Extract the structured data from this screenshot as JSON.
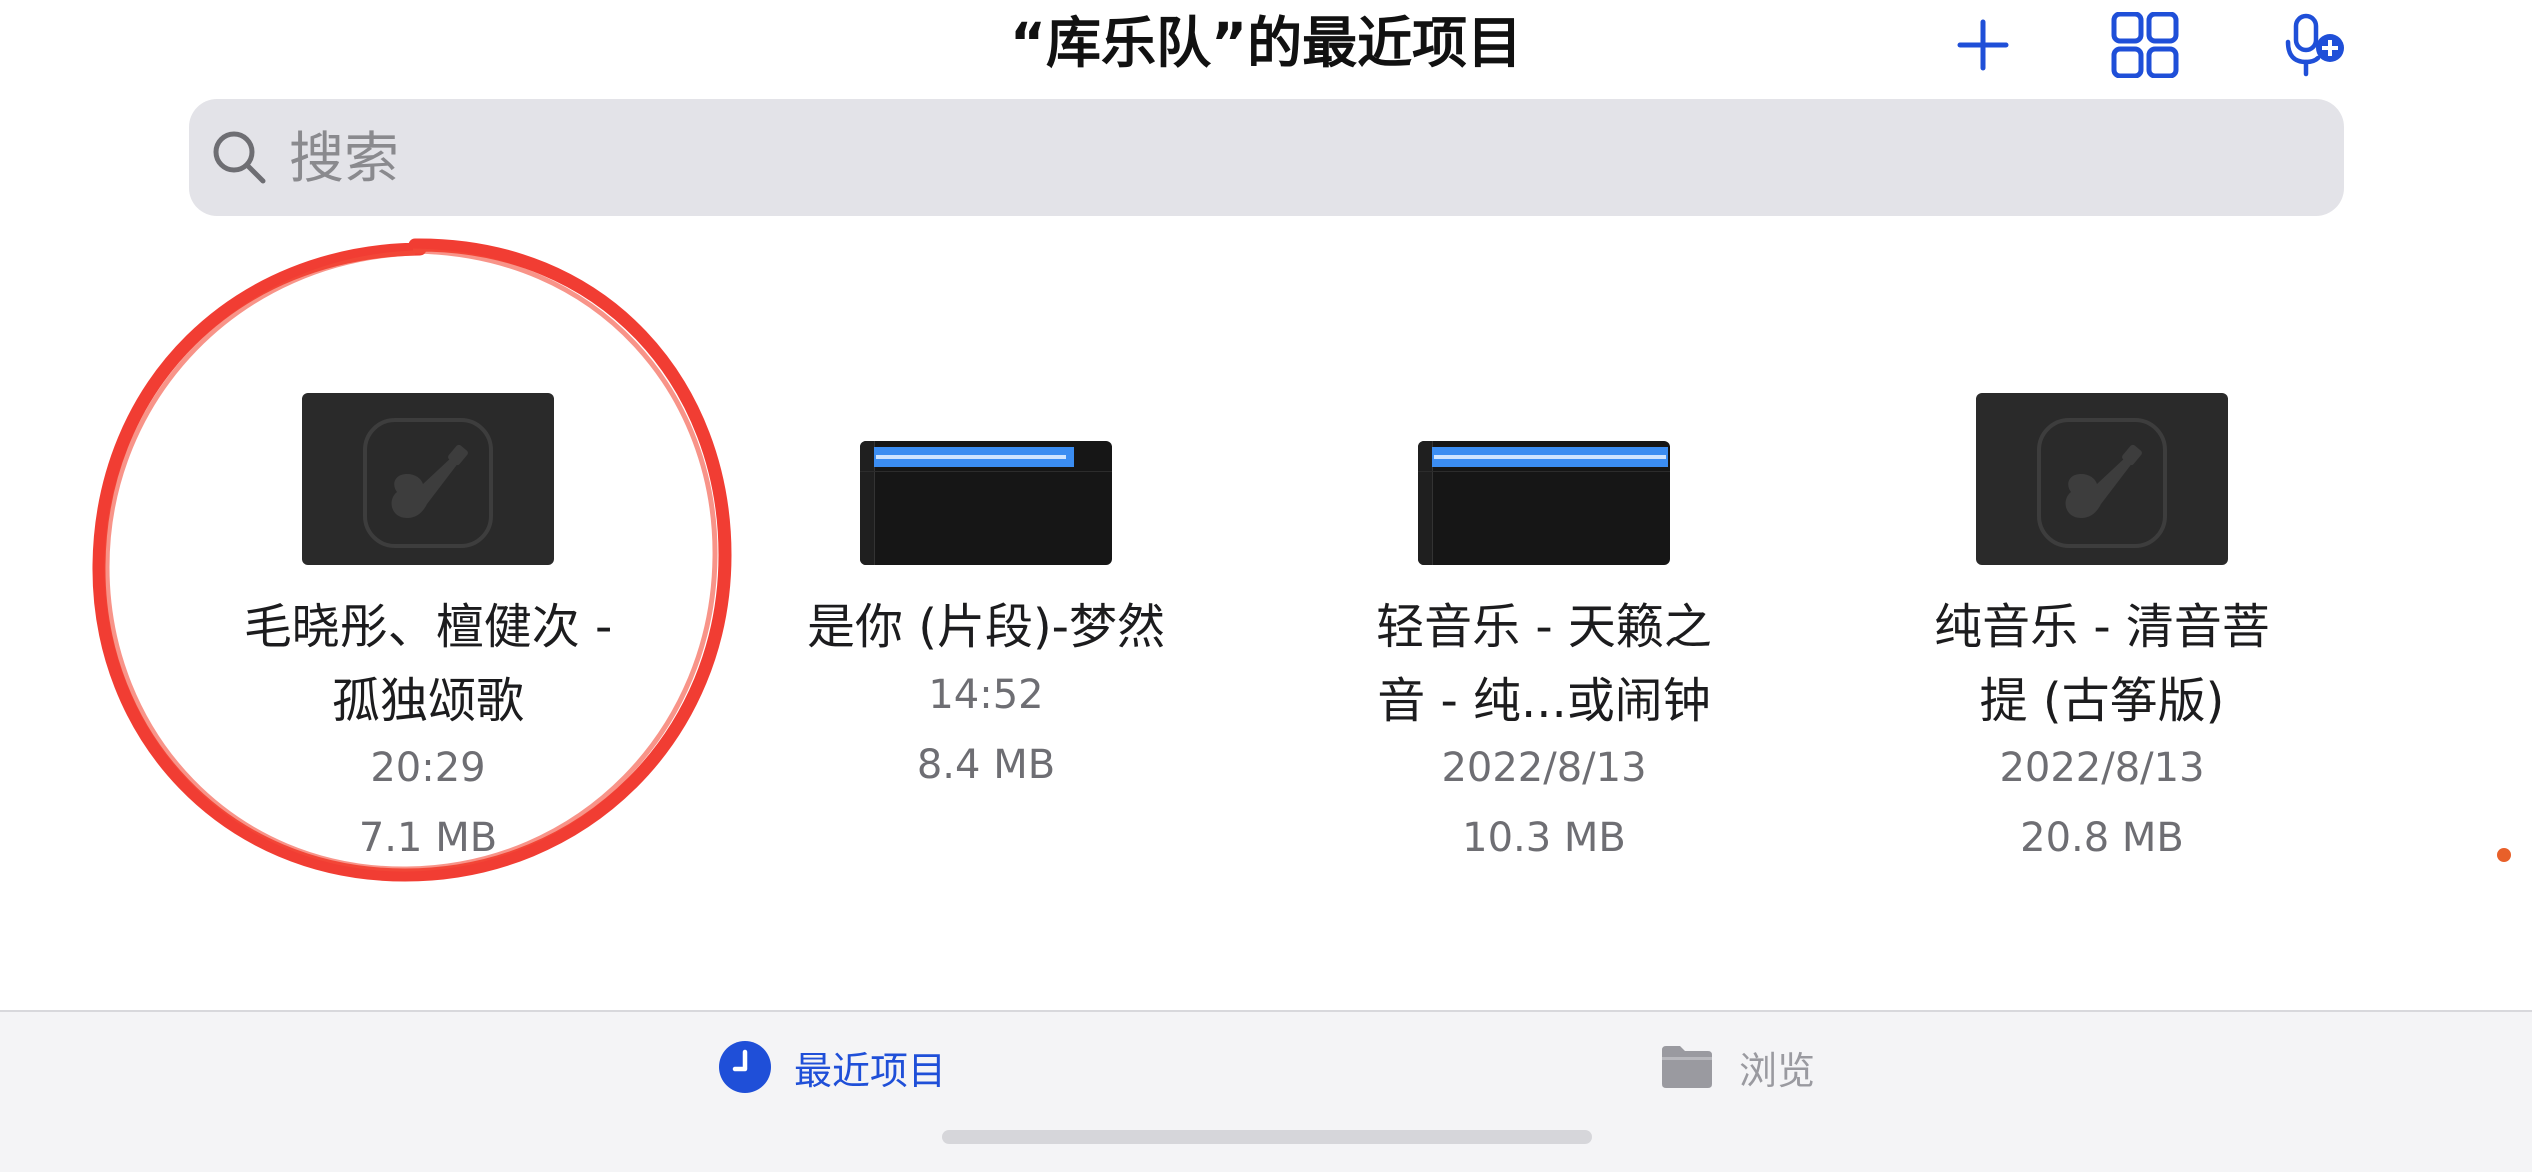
{
  "header": {
    "title": "“库乐队”的最近项目",
    "add_icon": "plus-icon",
    "view_icon": "grid-view-icon",
    "record_icon": "mic-add-icon"
  },
  "search": {
    "placeholder": "搜索",
    "value": ""
  },
  "items": [
    {
      "name_line1": "毛晓彤、檀健次 -",
      "name_line2": "孤独颂歌",
      "date": "20:29",
      "size": "7.1 MB",
      "thumbnail": "garageband-app-icon"
    },
    {
      "name_line1": "是你 (片段)-梦然",
      "name_line2": "",
      "date": "14:52",
      "size": "8.4 MB",
      "thumbnail": "audio-track-preview"
    },
    {
      "name_line1": "轻音乐 - 天籁之",
      "name_line2": "音 - 纯...或闹钟",
      "date": "2022/8/13",
      "size": "10.3 MB",
      "thumbnail": "audio-track-preview"
    },
    {
      "name_line1": "纯音乐 - 清音菩",
      "name_line2": "提 (古筝版)",
      "date": "2022/8/13",
      "size": "20.8 MB",
      "thumbnail": "garageband-app-icon"
    }
  ],
  "tabbar": {
    "recents_label": "最近项目",
    "browse_label": "浏览",
    "recents_icon": "clock-icon",
    "browse_icon": "folder-icon"
  },
  "colors": {
    "accent": "#1f4fd8",
    "annotation": "#f02d22"
  }
}
